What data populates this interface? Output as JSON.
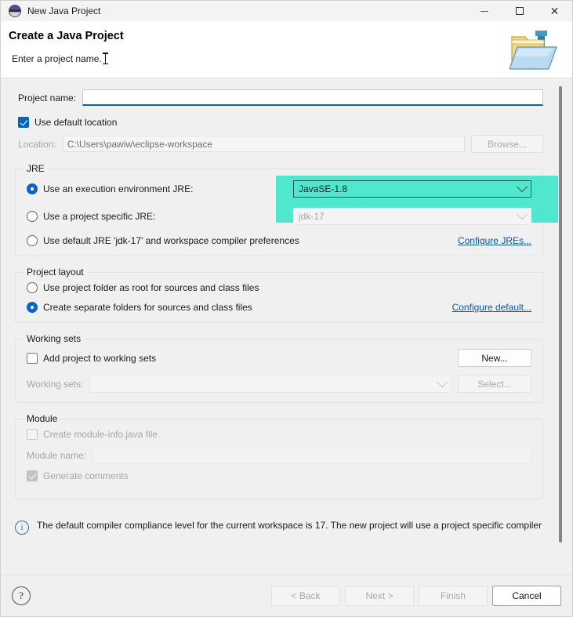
{
  "window": {
    "title": "New Java Project",
    "app_icon": "java-eclipse-icon",
    "controls": {
      "minimize": "minimize-icon",
      "maximize": "maximize-icon",
      "close": "close-icon"
    }
  },
  "banner": {
    "title": "Create a Java Project",
    "subtitle": "Enter a project name.",
    "image": "java-project-folder-icon"
  },
  "project_name": {
    "label": "Project name:",
    "value": "",
    "placeholder": ""
  },
  "location": {
    "use_default_label": "Use default location",
    "use_default_checked": true,
    "label": "Location:",
    "value": "C:\\Users\\pawiw\\eclipse-workspace",
    "browse_label": "Browse..."
  },
  "jre": {
    "group_title": "JRE",
    "options": [
      {
        "label": "Use an execution environment JRE:",
        "selected": true
      },
      {
        "label": "Use a project specific JRE:",
        "selected": false
      },
      {
        "label": "Use default JRE 'jdk-17' and workspace compiler preferences",
        "selected": false
      }
    ],
    "execution_env_value": "JavaSE-1.8",
    "specific_jre_value": "jdk-17",
    "configure_link": "Configure JREs...",
    "highlight_color": "#4fe8cf"
  },
  "project_layout": {
    "group_title": "Project layout",
    "options": [
      {
        "label": "Use project folder as root for sources and class files",
        "selected": false
      },
      {
        "label": "Create separate folders for sources and class files",
        "selected": true
      }
    ],
    "configure_link": "Configure default..."
  },
  "working_sets": {
    "group_title": "Working sets",
    "add_label": "Add project to working sets",
    "add_checked": false,
    "new_label": "New...",
    "sets_label": "Working sets:",
    "sets_value": "",
    "select_label": "Select..."
  },
  "module": {
    "group_title": "Module",
    "create_module_info_label": "Create module-info.java file",
    "create_module_info_checked": false,
    "module_name_label": "Module name:",
    "module_name_value": "",
    "generate_comments_label": "Generate comments",
    "generate_comments_checked": true
  },
  "info": {
    "icon": "info-icon",
    "message": "The default compiler compliance level for the current workspace is 17. The new project will use a project specific compiler"
  },
  "footer": {
    "help_label": "?",
    "back_label": "< Back",
    "next_label": "Next >",
    "finish_label": "Finish",
    "cancel_label": "Cancel"
  }
}
